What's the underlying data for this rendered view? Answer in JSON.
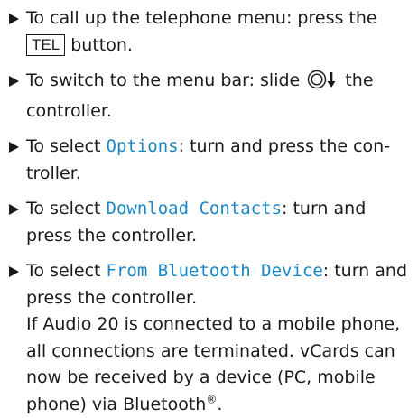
{
  "colors": {
    "menu_item": "#1a86c4",
    "text": "#1a1a1a"
  },
  "steps": [
    {
      "pre": "To call up the telephone menu: press the",
      "button": "TEL",
      "post": "button."
    },
    {
      "pre": "To switch to the menu bar: slide",
      "icon": "controller-slide-down-icon",
      "post": "the controller."
    },
    {
      "pre": "To select",
      "menu": "Options",
      "post": ": turn and press the con-troller."
    },
    {
      "pre": "To select",
      "menu": "Download Contacts",
      "post": ": turn and press the controller."
    },
    {
      "pre": "To select",
      "menu": "From Bluetooth Device",
      "post": ": turn and press the controller.",
      "note_a": "If Audio 20 is connected to a mobile phone, all connections are terminated. vCards can now be received by a device (PC, mobile phone) via Bluetooth",
      "note_reg": "®",
      "note_end": "."
    }
  ]
}
